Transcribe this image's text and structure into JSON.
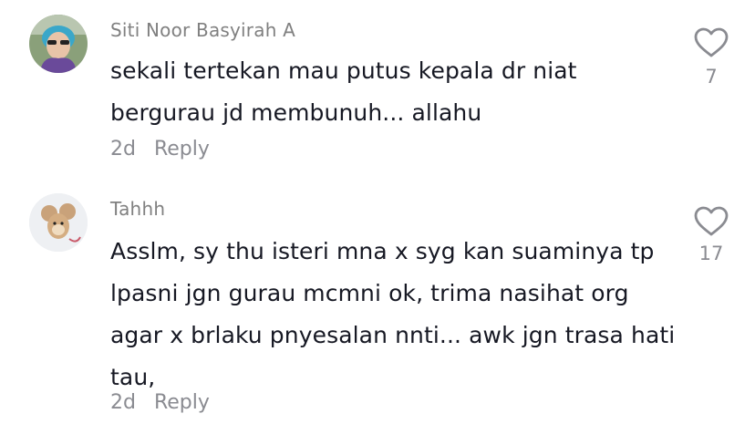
{
  "comments": [
    {
      "username": "Siti Noor Basyirah A",
      "text": "sekali tertekan mau putus kepala dr niat bergurau jd membunuh... allahu",
      "time": "2d",
      "reply_label": "Reply",
      "likes": "7",
      "avatar_icon": "user-photo-avatar"
    },
    {
      "username": "Tahhh",
      "text": "Asslm, sy thu isteri mna x syg kan suaminya tp lpasni jgn gurau mcmni ok, trima nasihat org agar x brlaku pnyesalan nnti... awk jgn trasa hati tau,",
      "time": "2d",
      "reply_label": "Reply",
      "likes": "17",
      "avatar_icon": "cartoon-mouse-avatar"
    }
  ],
  "colors": {
    "username": "#808080",
    "text": "#161823",
    "meta": "#8a8b91"
  },
  "icons": {
    "like": "heart-outline-icon"
  }
}
